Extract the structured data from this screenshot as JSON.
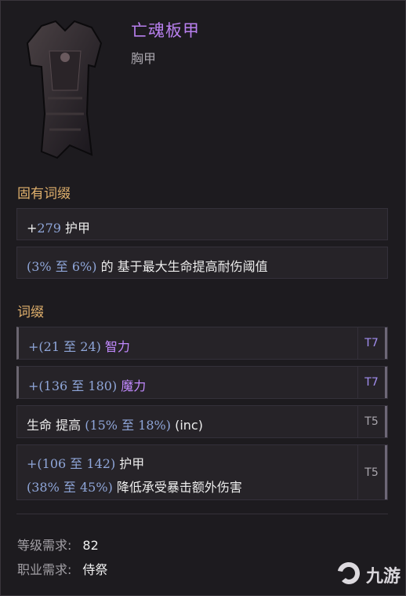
{
  "item": {
    "name": "亡魂板甲",
    "type": "胸甲",
    "image_icon": "dark-chest-armor-icon"
  },
  "implicit": {
    "heading": "固有词缀",
    "rows": [
      {
        "prefix": "+",
        "n1": "279",
        "label": "护甲"
      },
      {
        "open": "(",
        "n1": "3%",
        "mid": " 至 ",
        "n2": "6%",
        "close": ")",
        "label": "的 基于最大生命提高耐伤阈值"
      }
    ]
  },
  "affixes": {
    "heading": "词缀",
    "rows": [
      {
        "prefix": "+(",
        "n1": "21",
        "mid": " 至 ",
        "n2": "24",
        "close": ")",
        "label": "智力",
        "tier": "T7"
      },
      {
        "prefix": "+(",
        "n1": "136",
        "mid": " 至 ",
        "n2": "180",
        "close": ")",
        "label": "魔力",
        "tier": "T7"
      },
      {
        "lead": "生命 提高",
        "open": "(",
        "n1": "15%",
        "mid": " 至 ",
        "n2": "18%",
        "close": ")",
        "tail": "(inc)",
        "tier": "T5"
      },
      {
        "line1": {
          "prefix": "+(",
          "n1": "106",
          "mid": " 至 ",
          "n2": "142",
          "close": ")",
          "label": "护甲"
        },
        "line2": {
          "open": "(",
          "n1": "38%",
          "mid": " 至 ",
          "n2": "45%",
          "close": ")",
          "label": "降低承受暴击额外伤害"
        },
        "tier": "T5"
      }
    ]
  },
  "requirements": {
    "level_label": "等级需求:",
    "level_value": "82",
    "class_label": "职业需求:",
    "class_value": "侍祭"
  },
  "watermark": {
    "text": "九游",
    "icon": "jiuyou-logo-icon"
  },
  "colors": {
    "name": "#b980ef",
    "heading": "#e0b06c",
    "number": "#8fa6d9",
    "attr": "#c28aff"
  }
}
